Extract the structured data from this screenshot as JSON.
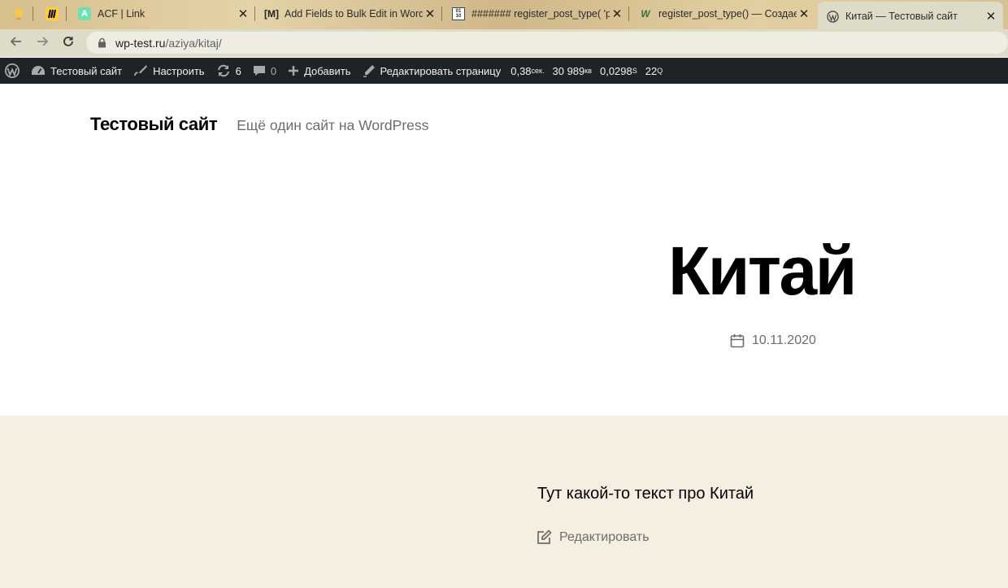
{
  "browser": {
    "tabs": [
      {
        "title": "",
        "icon": "lightbulb-icon",
        "pinned": true
      },
      {
        "title": "",
        "icon": "miro-icon",
        "pinned": true
      },
      {
        "title": "ACF | Link",
        "icon": "acf-icon"
      },
      {
        "title": "Add Fields to Bulk Edit in Word",
        "icon": "m-bracket-icon"
      },
      {
        "title": "####### register_post_type( 'p",
        "icon": "code-file-icon"
      },
      {
        "title": "register_post_type() — Создает",
        "icon": "wp-developer-icon"
      },
      {
        "title": "Китай — Тестовый сайт",
        "icon": "wordpress-icon",
        "active": true
      }
    ],
    "close_glyph": "✕",
    "url_host": "wp-test.ru",
    "url_path": "/aziya/kitaj/"
  },
  "adminbar": {
    "site_name": "Тестовый сайт",
    "customize": "Настроить",
    "updates_count": "6",
    "comments_count": "0",
    "new": "Добавить",
    "edit_page": "Редактировать страницу",
    "time": "0,38",
    "time_unit": "сек.",
    "memory": "30 989",
    "memory_unit": "кв",
    "query_time": "0,0298",
    "query_time_unit": "S",
    "queries": "22",
    "queries_unit": "Q"
  },
  "site": {
    "title": "Тестовый сайт",
    "description": "Ещё один сайт на WordPress"
  },
  "post": {
    "title": "Китай",
    "date": "10.11.2020",
    "content": "Тут какой-то текст про Китай",
    "edit_label": "Редактировать"
  },
  "colors": {
    "adminbar_bg": "#1d2327",
    "content_bg": "#f4efe1",
    "meta_text": "#6d6d6d"
  }
}
